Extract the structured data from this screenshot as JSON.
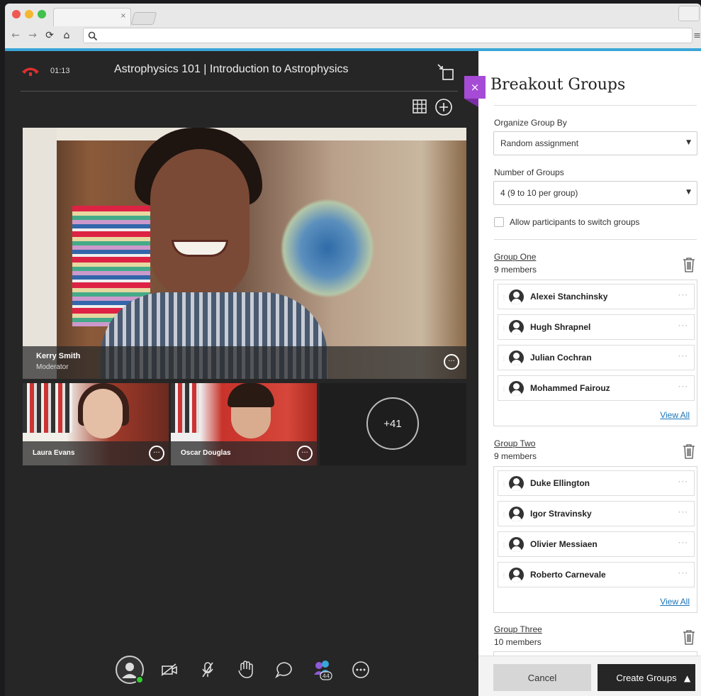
{
  "browser": {
    "tab_close": "×",
    "nav": {
      "back": "←",
      "forward": "→",
      "reload": "⟳",
      "home": "⌂"
    },
    "address_icon": "search-icon",
    "menu_icon": "≡"
  },
  "session": {
    "timer": "01:13",
    "title": "Astrophysics 101 | Introduction to Astrophysics"
  },
  "main_video": {
    "name": "Kerry Smith",
    "role": "Moderator",
    "more": "···"
  },
  "thumbnails": [
    {
      "name": "Laura Evans",
      "more": "···"
    },
    {
      "name": "Oscar Douglas",
      "more": "···"
    }
  ],
  "overflow_count": "+41",
  "controls": {
    "attendees_badge": "44"
  },
  "panel": {
    "close": "×",
    "title": "Breakout Groups",
    "organize_label": "Organize Group By",
    "organize_value": "Random assignment",
    "number_label": "Number of Groups",
    "number_value": "4 (9 to 10 per group)",
    "switch_label": "Allow participants to switch groups",
    "groups": [
      {
        "title": "Group One",
        "count": "9 members",
        "members": [
          "Alexei Stanchinsky",
          "Hugh Shrapnel",
          "Julian Cochran",
          "Mohammed Fairouz"
        ],
        "view_all": "View All"
      },
      {
        "title": "Group Two",
        "count": "9 members",
        "members": [
          "Duke Ellington",
          "Igor Stravinsky",
          "Olivier Messiaen",
          "Roberto Carnevale"
        ],
        "view_all": "View All"
      },
      {
        "title": "Group Three",
        "count": "10 members"
      }
    ],
    "cancel": "Cancel",
    "create": "Create Groups"
  },
  "colors": {
    "accent": "#3aa6d8",
    "close_tab": "#a64bd6",
    "link": "#1a74b8"
  }
}
